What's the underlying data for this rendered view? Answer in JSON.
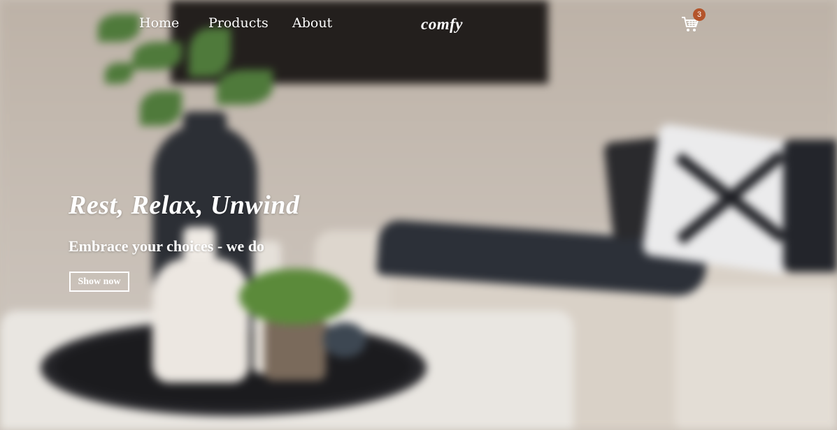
{
  "nav": {
    "links": [
      {
        "label": "Home"
      },
      {
        "label": "Products"
      },
      {
        "label": "About"
      }
    ],
    "logo": "comfy",
    "cart": {
      "icon": "cart-icon",
      "count": "3",
      "badge_color": "#b4542a"
    }
  },
  "hero": {
    "title": "Rest, Relax, Unwind",
    "subtitle": "Embrace your choices - we do",
    "button_label": "Show now",
    "background": "blurred-living-room-photo"
  }
}
